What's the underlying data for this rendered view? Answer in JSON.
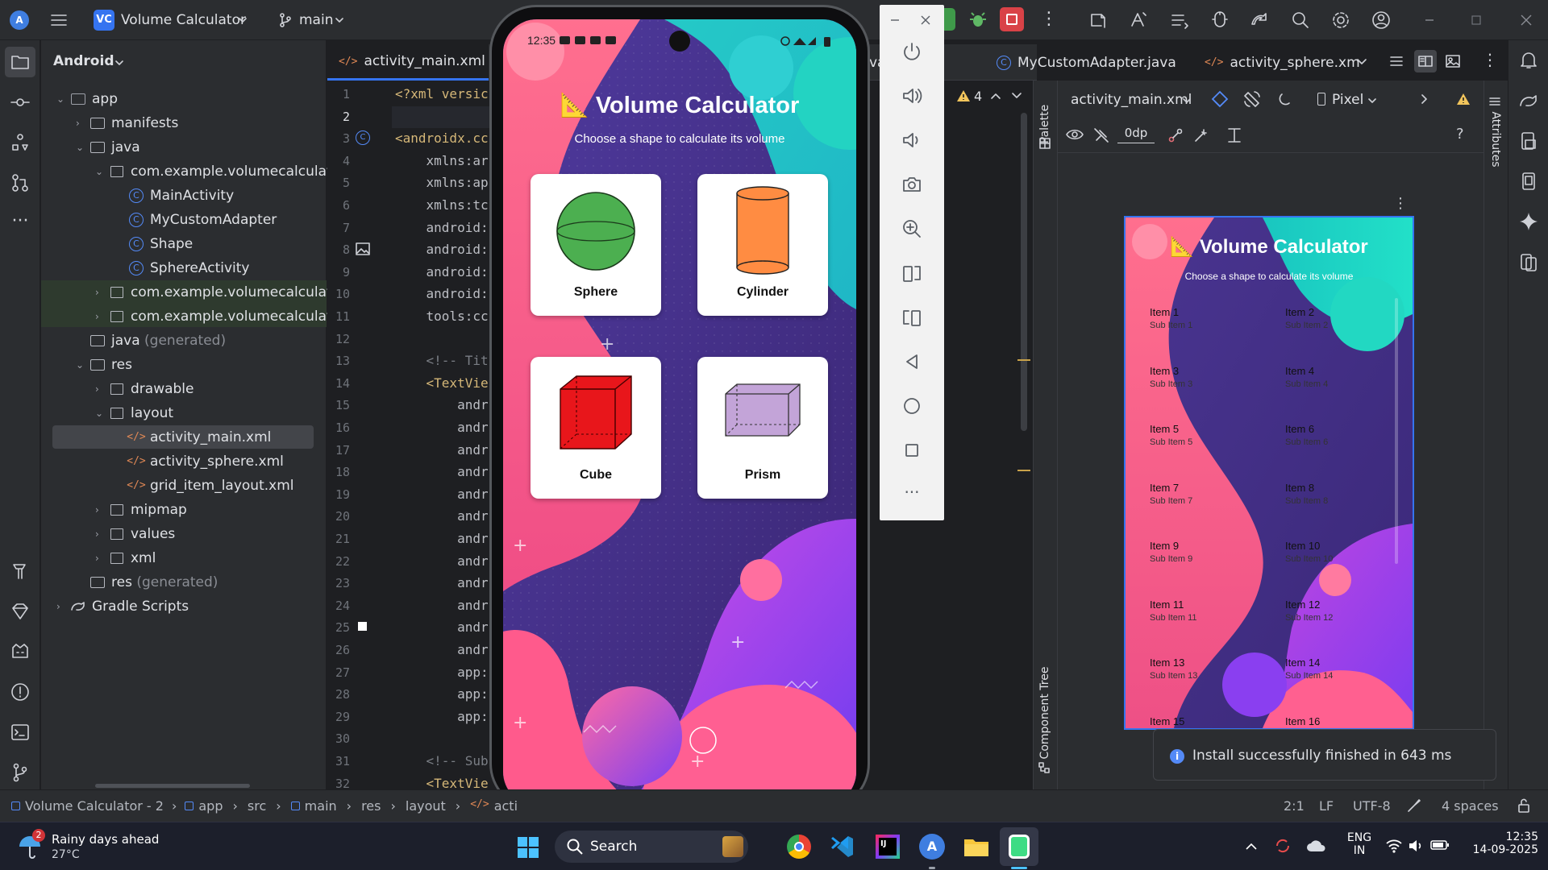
{
  "titlebar": {
    "project_badge": "VC",
    "project_name": "Volume Calculator",
    "branch": "main"
  },
  "editor_tabs": [
    {
      "label": "activity_main.xml",
      "close": "×"
    },
    {
      "label": "va"
    },
    {
      "label": "MyCustomAdapter.java"
    },
    {
      "label": "activity_sphere.xm"
    }
  ],
  "project_panel": {
    "view_selector": "Android",
    "tree": [
      {
        "label": "app"
      },
      {
        "label": "manifests"
      },
      {
        "label": "java"
      },
      {
        "label": "com.example.volumecalculator"
      },
      {
        "label": "MainActivity"
      },
      {
        "label": "MyCustomAdapter"
      },
      {
        "label": "Shape"
      },
      {
        "label": "SphereActivity"
      },
      {
        "label": "com.example.volumecalculator"
      },
      {
        "label": "com.example.volumecalculator"
      },
      {
        "label": "java",
        "suffix": "(generated)"
      },
      {
        "label": "res"
      },
      {
        "label": "drawable"
      },
      {
        "label": "layout"
      },
      {
        "label": "activity_main.xml"
      },
      {
        "label": "activity_sphere.xml"
      },
      {
        "label": "grid_item_layout.xml"
      },
      {
        "label": "mipmap"
      },
      {
        "label": "values"
      },
      {
        "label": "xml"
      },
      {
        "label": "res",
        "suffix": "(generated)"
      },
      {
        "label": "Gradle Scripts"
      }
    ]
  },
  "code": {
    "line_numbers": [
      "1",
      "2",
      "3",
      "4",
      "5",
      "6",
      "7",
      "8",
      "9",
      "10",
      "11",
      "12",
      "13",
      "14",
      "15",
      "16",
      "17",
      "18",
      "19",
      "20",
      "21",
      "22",
      "23",
      "24",
      "25",
      "26",
      "27",
      "28",
      "29",
      "30",
      "31",
      "32"
    ],
    "lines": [
      "<?xml versic",
      "",
      "<androidx.cc",
      "    xmlns:ar",
      "    xmlns:ap",
      "    xmlns:tc",
      "    android:",
      "    android:",
      "    android:",
      "    android:",
      "    tools:cc",
      "",
      "    <!-- Tit",
      "    <TextVie",
      "        andr",
      "        andr",
      "        andr",
      "        andr",
      "        andr",
      "        andr",
      "        andr",
      "        andr",
      "        andr",
      "        andr",
      "        andr",
      "        andr",
      "        app:",
      "        app:",
      "        app:",
      "",
      "    <!-- Sub",
      "    <TextVie"
    ],
    "warning_count": "4"
  },
  "phone": {
    "status_time": "12:35",
    "app_title": "Volume Calculator",
    "title_emoji": "📐",
    "subtitle": "Choose a shape to calculate its volume",
    "shapes": [
      {
        "name": "Sphere",
        "color": "#4caf50"
      },
      {
        "name": "Cylinder",
        "color": "#ff8c42"
      },
      {
        "name": "Cube",
        "color": "#e8161b"
      },
      {
        "name": "Prism",
        "color": "#c3a4d8"
      }
    ]
  },
  "design_panel": {
    "file_selector": "activity_main.xml",
    "device": "Pixel",
    "margin_value": "0dp",
    "side_labels": {
      "palette": "Palette",
      "component_tree": "Component Tree",
      "attributes": "Attributes"
    },
    "preview_title": "Volume Calculator",
    "preview_subtitle": "Choose a shape to calculate its volume",
    "preview_items": [
      {
        "item": "Item 1",
        "sub": "Sub Item 1"
      },
      {
        "item": "Item 2",
        "sub": "Sub Item 2"
      },
      {
        "item": "Item 3",
        "sub": "Sub Item 3"
      },
      {
        "item": "Item 4",
        "sub": "Sub Item 4"
      },
      {
        "item": "Item 5",
        "sub": "Sub Item 5"
      },
      {
        "item": "Item 6",
        "sub": "Sub Item 6"
      },
      {
        "item": "Item 7",
        "sub": "Sub Item 7"
      },
      {
        "item": "Item 8",
        "sub": "Sub Item 8"
      },
      {
        "item": "Item 9",
        "sub": "Sub Item 9"
      },
      {
        "item": "Item 10",
        "sub": "Sub Item 10"
      },
      {
        "item": "Item 11",
        "sub": "Sub Item 11"
      },
      {
        "item": "Item 12",
        "sub": "Sub Item 12"
      },
      {
        "item": "Item 13",
        "sub": "Sub Item 13"
      },
      {
        "item": "Item 14",
        "sub": "Sub Item 14"
      },
      {
        "item": "Item 15",
        "sub": ""
      },
      {
        "item": "Item 16",
        "sub": ""
      }
    ]
  },
  "toast": {
    "message": "Install successfully finished in 643 ms"
  },
  "statusbar": {
    "breadcrumbs": [
      "Volume Calculator - 2",
      "app",
      "src",
      "main",
      "res",
      "layout",
      "acti"
    ],
    "position": "2:1",
    "line_ending": "LF",
    "encoding": "UTF-8",
    "indent": "4 spaces"
  },
  "taskbar": {
    "weather_badge": "2",
    "weather_title": "Rainy days ahead",
    "weather_temp": "27°C",
    "search_label": "Search",
    "lang_top": "ENG",
    "lang_bottom": "IN",
    "time": "12:35",
    "date": "14-09-2025"
  }
}
